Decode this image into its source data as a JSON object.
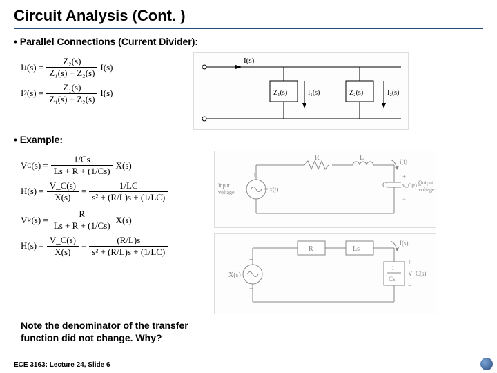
{
  "title": "Circuit Analysis (Cont. )",
  "bullets": {
    "b1": "Parallel Connections (Current Divider):",
    "b2": "Example:"
  },
  "eq": {
    "i1_lhs": "I",
    "i1_sub": "1",
    "i1_arg": "(s) =",
    "i1_num": "Z₂(s)",
    "i1_den": "Z₁(s) + Z₂(s)",
    "i1_rhs": " I(s)",
    "i2_lhs": "I",
    "i2_sub": "2",
    "i2_arg": "(s) =",
    "i2_num": "Z₁(s)",
    "i2_den": "Z₁(s) + Z₂(s)",
    "i2_rhs": " I(s)",
    "vc_lhs": "V",
    "vc_sub": "C",
    "vc_arg": "(s) =",
    "vc_num": "1/Cs",
    "vc_den": "Ls + R + (1/Cs)",
    "vc_rhs": " X(s)",
    "h1_lhs": "H(s) =",
    "h1_mid_num": "V_C(s)",
    "h1_mid_den": "X(s)",
    "h1_eq": " = ",
    "h1_num": "1/LC",
    "h1_den": "s² + (R/L)s + (1/LC)",
    "vr_lhs": "V",
    "vr_sub": "R",
    "vr_arg": "(s) =",
    "vr_num": "R",
    "vr_den": "Ls + R + (1/Cs)",
    "vr_rhs": " X(s)",
    "h2_lhs": "H(s) =",
    "h2_mid_num": "V_C(s)",
    "h2_mid_den": "X(s)",
    "h2_eq": " = ",
    "h2_num": "(R/L)s",
    "h2_den": "s² + (R/L)s + (1/LC)"
  },
  "diag1": {
    "Is": "I(s)",
    "Z1": "Z₁(s)",
    "Z2": "Z₂(s)",
    "I1": "I₁(s)",
    "I2": "I₂(s)"
  },
  "diag2": {
    "R": "R",
    "L": "L",
    "C": "C",
    "it": "i(t)",
    "in_label": "Input\nvoltage",
    "in_sym": "= x(t)",
    "vc": "v_C(t) =",
    "out_label": "Output\nvoltage",
    "plus": "+",
    "minus": "−"
  },
  "diag3": {
    "Xs": "X(s)",
    "R": "R",
    "Ls": "Ls",
    "Is": "I(s)",
    "oneCs": "1",
    "Cs": "Cs",
    "Vc": "V_C(s)",
    "plus": "+",
    "minus": "−"
  },
  "note1": "Note the denominator of the transfer",
  "note2": "function did not change. Why?",
  "footer": "ECE 3163: Lecture 24, Slide 6"
}
